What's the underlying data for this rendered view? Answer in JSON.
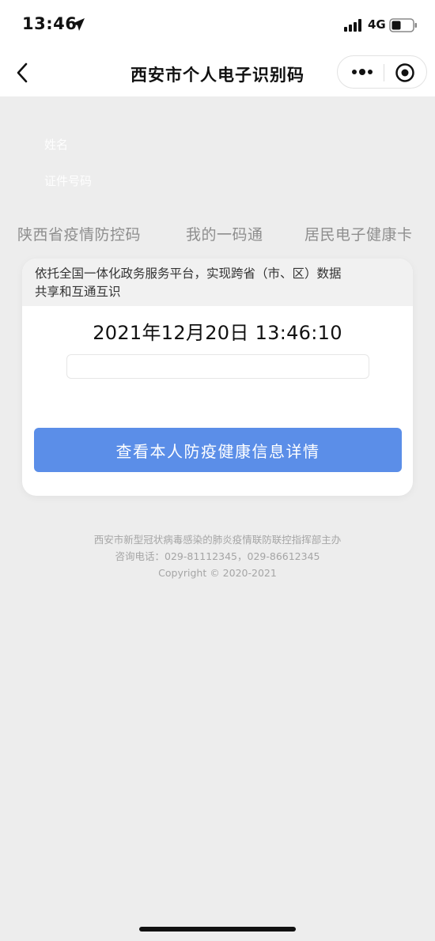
{
  "status_bar": {
    "time": "13:46",
    "network": "4G",
    "icons": [
      "location-arrow-icon",
      "signal-bars-icon",
      "battery-icon"
    ]
  },
  "nav": {
    "title": "西安市个人电子识别码",
    "icons": [
      "back-chevron-icon",
      "more-dots-icon",
      "close-miniprogram-icon"
    ]
  },
  "identity": {
    "name_label": "姓名",
    "id_label": "证件号码"
  },
  "tabs": [
    {
      "label": "陕西省疫情防控码"
    },
    {
      "label": "我的一码通"
    },
    {
      "label": "居民电子健康卡"
    }
  ],
  "card": {
    "notice_line1": "依托全国一体化政务服务平台，实现跨省（市、区）数据",
    "notice_line2": "共享和互通互识",
    "datetime": "2021年12月20日 13:46:10",
    "button_label": "查看本人防疫健康信息详情"
  },
  "footer": {
    "organizer": "西安市新型冠状病毒感染的肺炎疫情联防联控指挥部主办",
    "phone": "咨询电话：029-81112345，029-86612345",
    "copyright": "Copyright © 2020-2021"
  },
  "colors": {
    "accent_button": "#5b8ee8",
    "page_background": "#ededed",
    "tab_text": "#8e8e8e",
    "footer_text": "#a5a5a5"
  }
}
